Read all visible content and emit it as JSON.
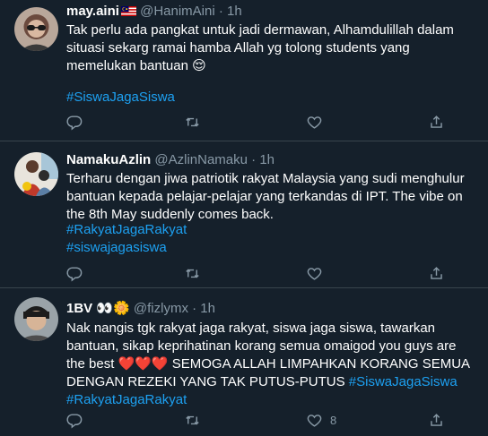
{
  "tweets": [
    {
      "name": "may.aini",
      "handle": "@HanimAini",
      "dot": "·",
      "time": "1h",
      "text": "Tak perlu ada pangkat untuk jadi dermawan,  Alhamdulillah dalam situasi sekarg ramai hamba Allah yg tolong students yang memelukan bantuan",
      "emoji": "😌",
      "hashtags": [
        "#SiswaJagaSiswa"
      ],
      "like_count": ""
    },
    {
      "name": "NamakuAzlin",
      "handle": "@AzlinNamaku",
      "dot": "·",
      "time": "1h",
      "text": "Terharu dengan jiwa patriotik rakyat Malaysia yang sudi menghulur bantuan kepada pelajar-pelajar yang terkandas di IPT. The vibe on the 8th May suddenly comes back.",
      "hashtags": [
        "#RakyatJagaRakyat",
        "#siswajagasiswa"
      ],
      "like_count": ""
    },
    {
      "name": "1BV",
      "name_emoji": "👀🌼",
      "handle": "@fizlymx",
      "dot": "·",
      "time": "1h",
      "text_line1": "Nak nangis tgk rakyat jaga rakyat, siswa jaga siswa, tawarkan",
      "text_line2": "bantuan, sikap keprihatinan korang semua omaigod you guys are",
      "text_line3_pre": "the best",
      "hearts": "❤️❤️❤️",
      "text_line3_post": " SEMOGA ALLAH LIMPAHKAN KORANG SEMUA",
      "text_line4_pre": "DENGAN REZEKI YANG TAK PUTUS-PUTUS ",
      "hashtags": [
        "#SiswaJagaSiswa",
        "#RakyatJagaRakyat"
      ],
      "like_count": "8"
    }
  ],
  "icons": [
    "reply-icon",
    "retweet-icon",
    "like-icon",
    "share-icon"
  ],
  "colors": {
    "background": "#15202b",
    "divider": "#38444d",
    "secondary": "#8899a6",
    "link": "#1da1f2",
    "heart": "#e0245e"
  }
}
